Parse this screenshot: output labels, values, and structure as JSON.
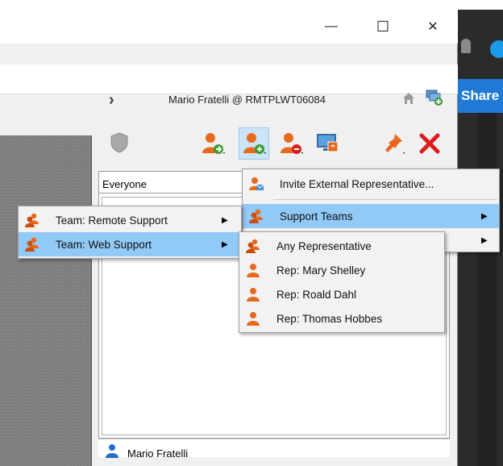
{
  "window": {
    "minimize_glyph": "—",
    "maximize_glyph": "☐",
    "close_glyph": "✕"
  },
  "header": {
    "chevron": "›",
    "user_host": "Mario Fratelli @ RMTPLWT06084"
  },
  "background_app": {
    "share_label": "Share"
  },
  "toolbar": {
    "icons": [
      "shield-icon",
      "add-user-icon",
      "invite-user-icon",
      "remove-user-icon",
      "screen-share-icon",
      "pin-icon",
      "close-x-icon"
    ]
  },
  "panel": {
    "filter_value": "Everyone",
    "current_user": "Mario Fratelli"
  },
  "invite_menu": {
    "items": [
      {
        "label": "Invite External Representative...",
        "icon": "invite-mail-icon"
      },
      {
        "label": "Support Teams",
        "icon": "team-icon",
        "submenu": true,
        "highlighted": true
      },
      {
        "label": "",
        "icon": "",
        "submenu": true
      }
    ]
  },
  "teams_menu": {
    "items": [
      {
        "label": "Team: Remote Support",
        "icon": "team-icon",
        "submenu": true
      },
      {
        "label": "Team: Web Support",
        "icon": "team-icon",
        "submenu": true,
        "highlighted": true
      }
    ]
  },
  "reps_menu": {
    "items": [
      {
        "label": "Any Representative",
        "icon": "team-icon"
      },
      {
        "label": "Rep: Mary Shelley",
        "icon": "rep-icon"
      },
      {
        "label": "Rep: Roald Dahl",
        "icon": "rep-icon"
      },
      {
        "label": "Rep: Thomas Hobbes",
        "icon": "rep-icon"
      }
    ]
  },
  "colors": {
    "accent_orange": "#e8691c",
    "highlight": "#91c9f7",
    "green_badge": "#3b9b33",
    "red_x": "#e01b1b"
  }
}
